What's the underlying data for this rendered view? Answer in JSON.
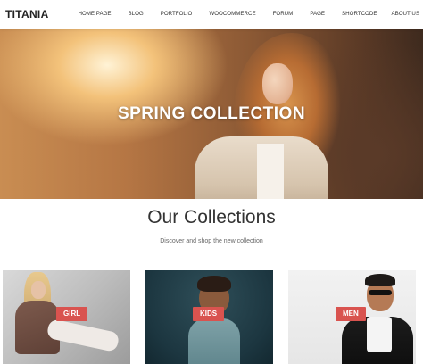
{
  "header": {
    "logo": "TITANIA",
    "nav": [
      "HOME PAGE",
      "BLOG",
      "PORTFOLIO",
      "WOOCOMMERCE",
      "FORUM",
      "PAGE",
      "SHORTCODE",
      "ABOUT US"
    ]
  },
  "hero": {
    "title": "SPRING COLLECTION"
  },
  "collections": {
    "title": "Our Collections",
    "subtitle": "Discover and shop the new collection",
    "cards": [
      {
        "label": "GIRL"
      },
      {
        "label": "KIDS"
      },
      {
        "label": "MEN"
      }
    ]
  },
  "colors": {
    "accent": "#d9534f",
    "header_bg": "#ffffff"
  }
}
